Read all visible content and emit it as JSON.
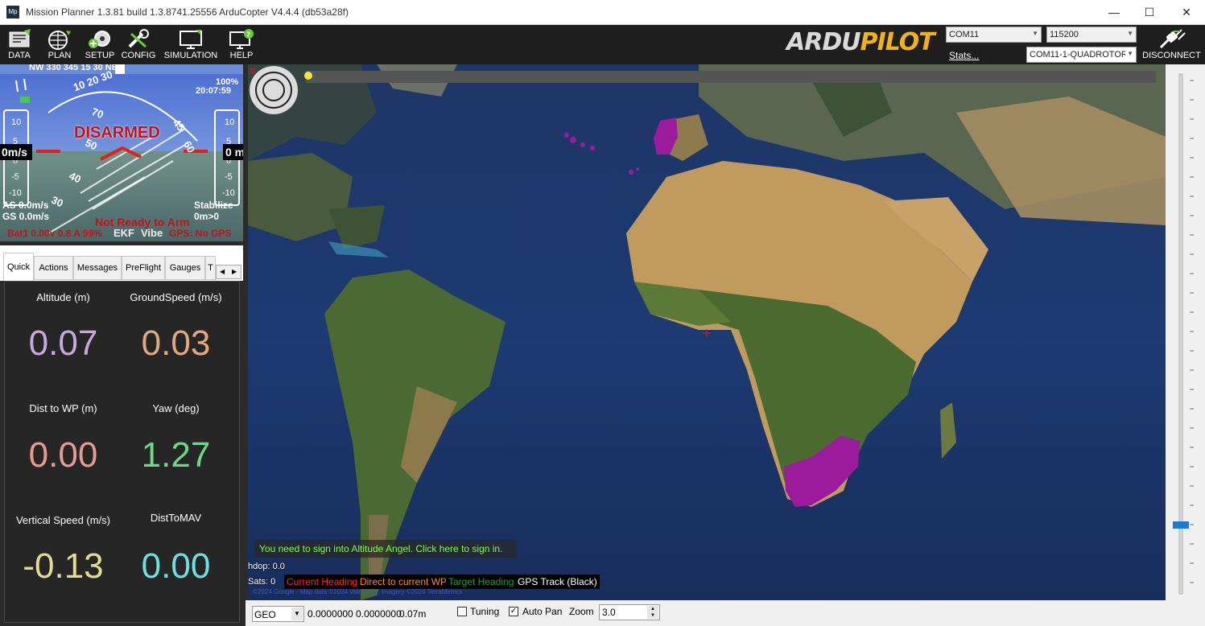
{
  "window": {
    "title": "Mission Planner 1.3.81 build 1.3.8741.25556 ArduCopter V4.4.4 (db53a28f)",
    "app_icon": "Mp",
    "minimize": "—",
    "maximize": "☐",
    "close": "✕"
  },
  "menu": {
    "items": [
      {
        "label": "DATA",
        "icon": "data-icon"
      },
      {
        "label": "PLAN",
        "icon": "plan-icon"
      },
      {
        "label": "SETUP",
        "icon": "setup-icon"
      },
      {
        "label": "CONFIG",
        "icon": "config-icon"
      },
      {
        "label": "SIMULATION",
        "icon": "simulation-icon"
      },
      {
        "label": "HELP",
        "icon": "help-icon"
      }
    ]
  },
  "connection": {
    "logo_part1": "ARDU",
    "logo_part2": "PILOT",
    "port": "COM11",
    "baud": "115200",
    "vehicle": "COM11-1-QUADROTOR",
    "stats_label": "Stats...",
    "disconnect_label": "DISCONNECT"
  },
  "hud": {
    "compass": "NW 330 345  15  30  NE",
    "battery_pct": "100%",
    "time": "20:07:59",
    "status": "DISARMED",
    "speed_readout": "0m/s",
    "alt_readout": "0 m",
    "airspeed": "AS 0.0m/s",
    "groundspeed": "GS 0.0m/s",
    "mode": "Stabilize",
    "mode_sub": "0m>0",
    "arm_status": "Not Ready to Arm",
    "battery": "Bat1 0.00v 0.8 A 99%",
    "ekf": "EKF",
    "vibe": "Vibe",
    "gps": "GPS: No GPS",
    "left_tape": [
      "10",
      "5",
      "0",
      "-5",
      "-10"
    ],
    "right_tape": [
      "10",
      "5",
      "0",
      "-5",
      "-10"
    ],
    "pitch": [
      "10 20 30",
      "45",
      "60",
      "70",
      "50",
      "40",
      "30"
    ]
  },
  "tabs": {
    "items": [
      "Quick",
      "Actions",
      "Messages",
      "PreFlight",
      "Gauges",
      "T"
    ],
    "active": "Quick"
  },
  "quick": [
    {
      "label": "Altitude (m)",
      "value": "0.07",
      "color": "#c8a8e0"
    },
    {
      "label": "GroundSpeed (m/s)",
      "value": "0.03",
      "color": "#e3a87f"
    },
    {
      "label": "Dist to WP (m)",
      "value": "0.00",
      "color": "#e89a94"
    },
    {
      "label": "Yaw (deg)",
      "value": "1.27",
      "color": "#6fd886"
    },
    {
      "label": "Vertical Speed (m/s)",
      "value": "-0.13",
      "color": "#e4dc94"
    },
    {
      "label": "DistToMAV",
      "value": "0.00",
      "color": "#6de0e3"
    }
  ],
  "map": {
    "top_counter": "0",
    "altitude_angel_msg": "You need to sign into Altitude Angel. Click here to sign in.",
    "hdop": "hdop: 0.0",
    "sats": "Sats: 0",
    "legend_current_heading": "Current Heading",
    "legend_direct_wp": "Direct to current WP",
    "legend_target_heading": "Target Heading",
    "legend_gps_track": "GPS Track (Black)",
    "copyright": "©2024 Google - Map data ©2024 Vale Atlas, Imagery ©2024 TerraMetrics",
    "colors": {
      "current_heading": "#ff2a1a",
      "direct_wp": "#ff8c1a",
      "target_heading": "#2a9a2a",
      "gps_track": "#ffffff"
    }
  },
  "bottom": {
    "coord_system": "GEO",
    "coords": "0.0000000 0.0000000",
    "alt": "0.07m",
    "tuning_label": "Tuning",
    "autopan_label": "Auto Pan",
    "zoom_label": "Zoom",
    "zoom_value": "3.0"
  }
}
